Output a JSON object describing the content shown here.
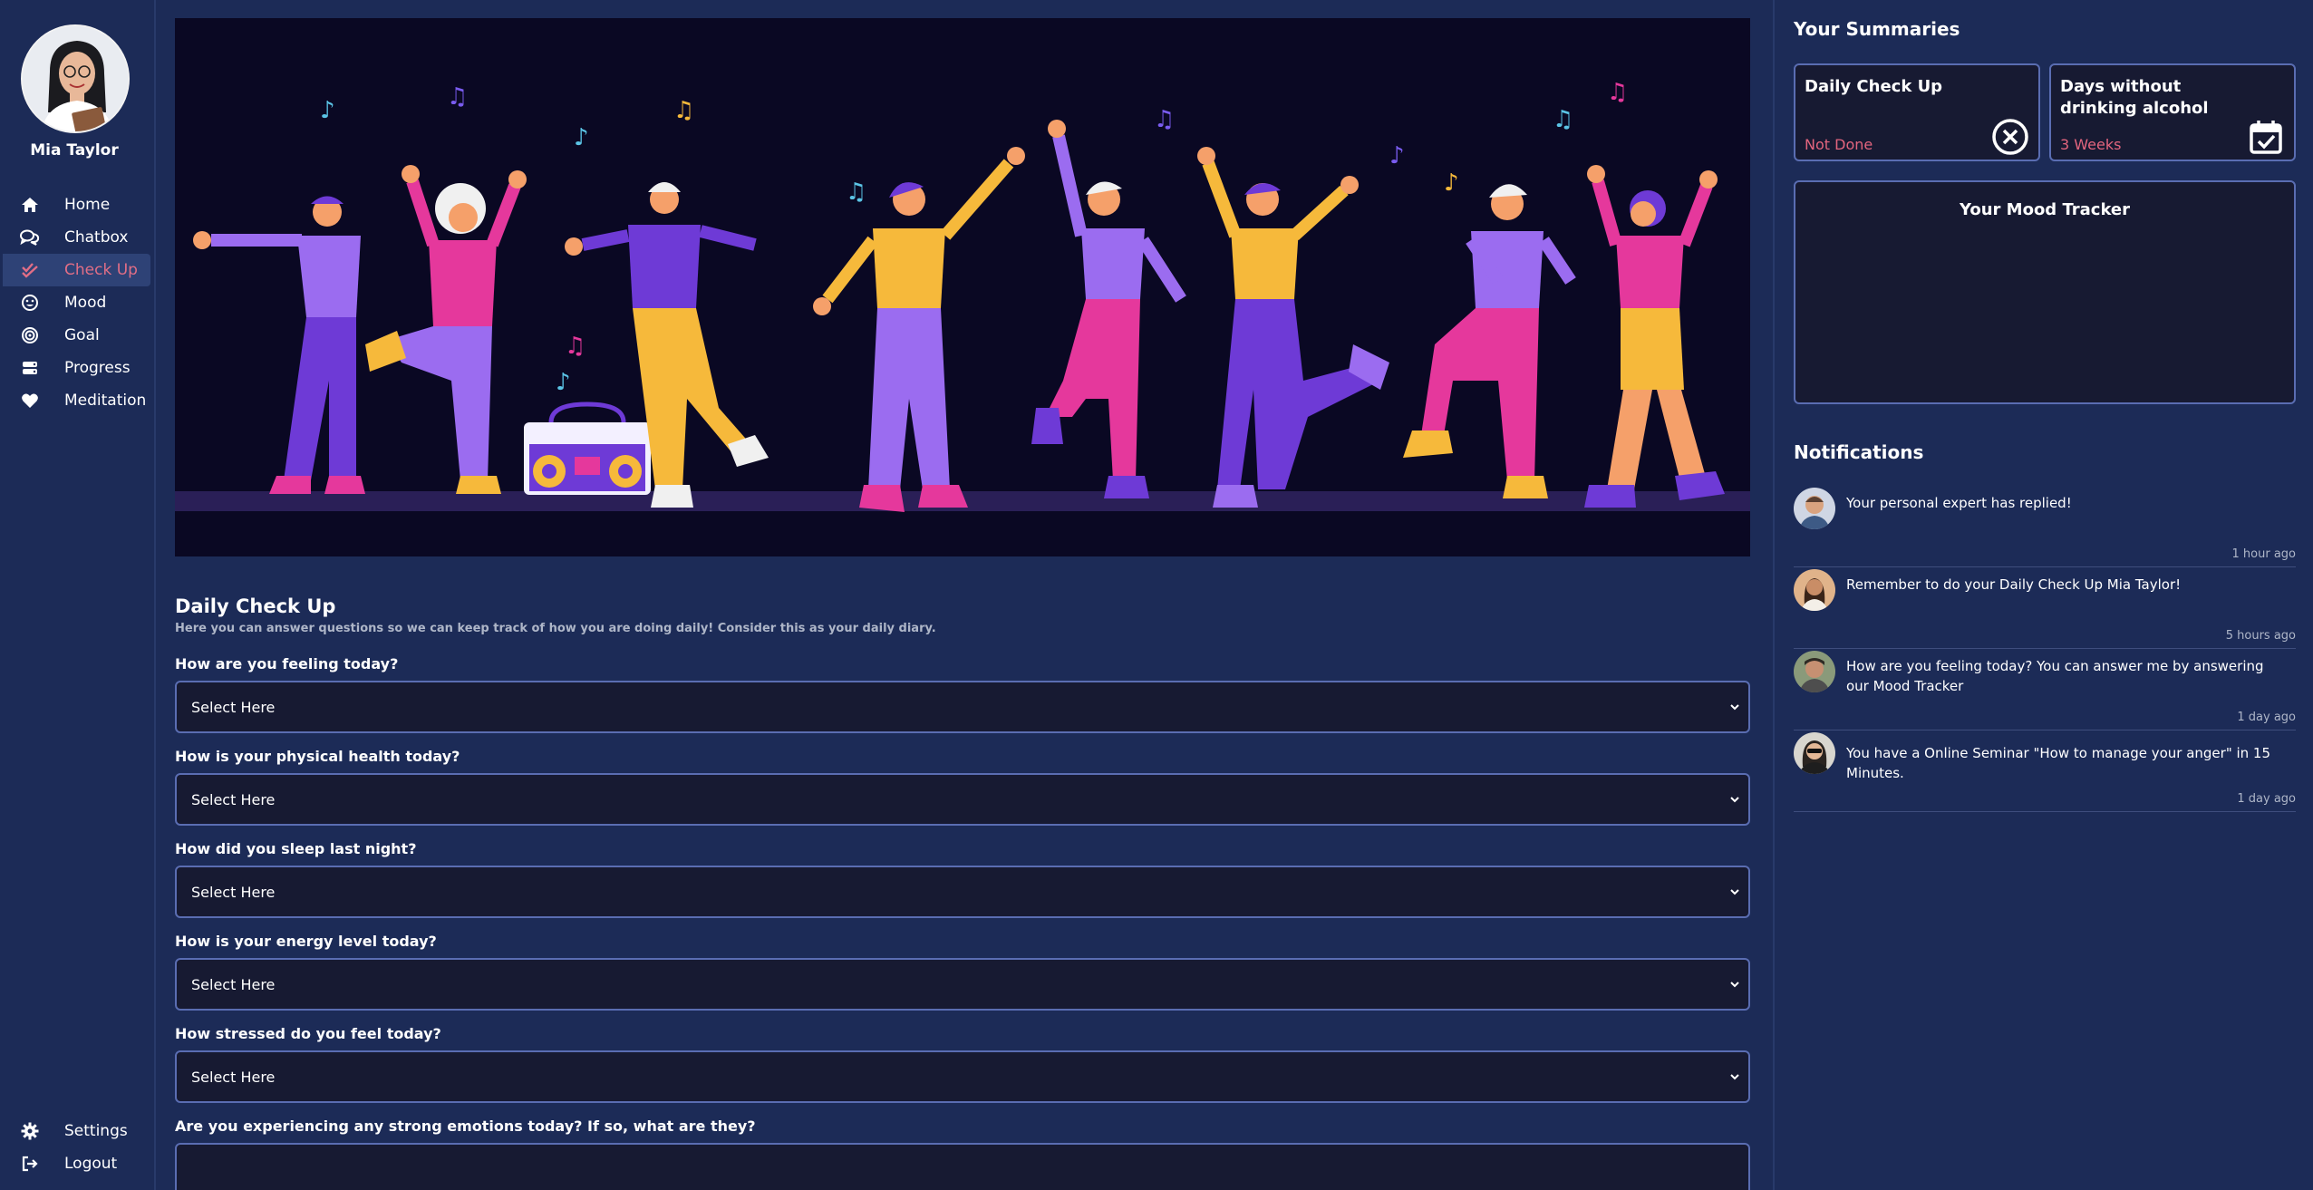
{
  "user": {
    "name": "Mia Taylor"
  },
  "sidebar": {
    "items": [
      {
        "label": "Home",
        "icon": "home-icon"
      },
      {
        "label": "Chatbox",
        "icon": "chat-icon"
      },
      {
        "label": "Check Up",
        "icon": "double-check-icon",
        "active": true
      },
      {
        "label": "Mood",
        "icon": "smiley-icon"
      },
      {
        "label": "Goal",
        "icon": "target-icon"
      },
      {
        "label": "Progress",
        "icon": "progress-icon"
      },
      {
        "label": "Meditation",
        "icon": "heart-icon"
      }
    ],
    "bottom": [
      {
        "label": "Settings",
        "icon": "gear-icon"
      },
      {
        "label": "Logout",
        "icon": "logout-icon"
      }
    ]
  },
  "checkup": {
    "title": "Daily Check Up",
    "subtitle": "Here you can answer questions so we can keep track of how you are doing daily! Consider this as your daily diary.",
    "questions": [
      {
        "label": "How are you feeling today?",
        "value": "Select Here"
      },
      {
        "label": "How is your physical health today?",
        "value": "Select Here"
      },
      {
        "label": "How did you sleep last night?",
        "value": "Select Here"
      },
      {
        "label": "How is your energy level today?",
        "value": "Select Here"
      },
      {
        "label": "How stressed do you feel today?",
        "value": "Select Here"
      },
      {
        "label": "Are you experiencing any strong emotions today? If so, what are they?",
        "value": ""
      }
    ]
  },
  "summaries": {
    "title": "Your Summaries",
    "daily_checkup": {
      "title": "Daily Check Up",
      "status": "Not Done",
      "icon": "close-circle-icon"
    },
    "sober": {
      "title": "Days without drinking alcohol",
      "status": "3 Weeks",
      "icon": "calendar-check-icon"
    },
    "mood_tracker": {
      "title": "Your Mood Tracker"
    }
  },
  "notifications": {
    "title": "Notifications",
    "items": [
      {
        "text": "Your personal expert has replied!",
        "time": "1 hour ago"
      },
      {
        "text": "Remember to do your Daily Check Up Mia Taylor!",
        "time": "5 hours ago"
      },
      {
        "text": "How are you feeling today? You can answer me by answering our Mood Tracker",
        "time": "1 day ago"
      },
      {
        "text": "You have a Online Seminar \"How to manage your anger\" in 15 Minutes.",
        "time": "1 day ago"
      }
    ]
  },
  "colors": {
    "background": "#1c2b57",
    "accent_pink": "#e3657e",
    "input_bg": "#171a32",
    "input_border": "#5a6db2"
  }
}
